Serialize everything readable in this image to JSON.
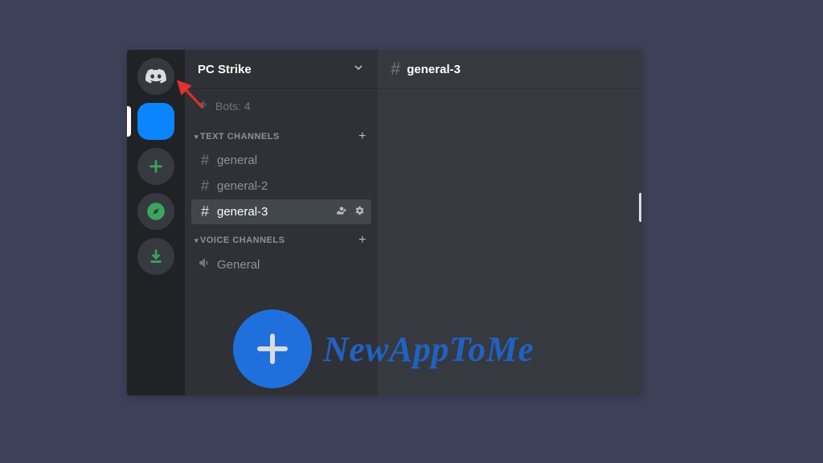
{
  "server": {
    "name": "PC Strike"
  },
  "bots_row": {
    "label": "Bots: 4"
  },
  "categories": {
    "text": {
      "label": "TEXT CHANNELS"
    },
    "voice": {
      "label": "VOICE CHANNELS"
    }
  },
  "text_channels": [
    {
      "name": "general"
    },
    {
      "name": "general-2"
    },
    {
      "name": "general-3"
    }
  ],
  "voice_channels": [
    {
      "name": "General"
    }
  ],
  "header": {
    "channel": "general-3"
  },
  "watermark": {
    "text": "NewAppToMe"
  }
}
